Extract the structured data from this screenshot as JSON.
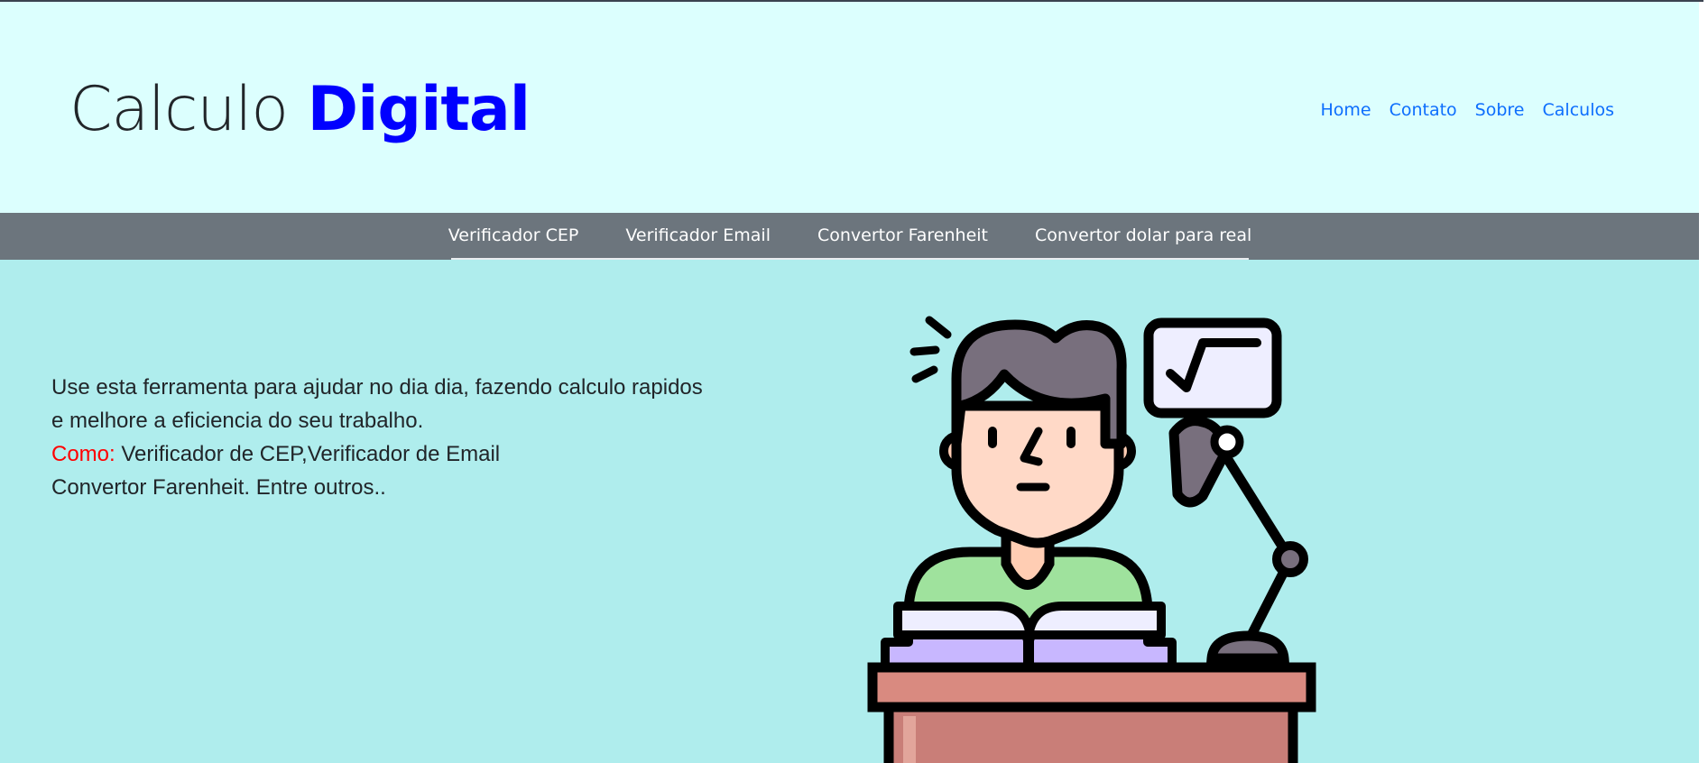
{
  "header": {
    "brand_light": "Calculo",
    "brand_bold": "Digital",
    "nav": [
      "Home",
      "Contato",
      "Sobre",
      "Calculos"
    ]
  },
  "subnav": {
    "items": [
      "Verificador CEP",
      "Verificador Email",
      "Convertor Farenheit",
      "Convertor dolar para real"
    ]
  },
  "main": {
    "line1": "Use esta ferramenta para ajudar no dia dia, fazendo calculo rapidos",
    "line2": "e melhore a eficiencia do seu trabalho.",
    "line3_prefix": "Como:",
    "line3_text": " Verificador de CEP,Verificador de Email",
    "line4": "Convertor Farenheit. Entre outros.."
  },
  "colors": {
    "header_bg": "#dcfffe",
    "brand_accent": "#0000ff",
    "nav_link": "#0d6efd",
    "subnav_bg": "#6c757d",
    "main_bg": "#afeded",
    "highlight": "#ff0000"
  },
  "icons": {
    "illustration": "student-studying-icon"
  }
}
